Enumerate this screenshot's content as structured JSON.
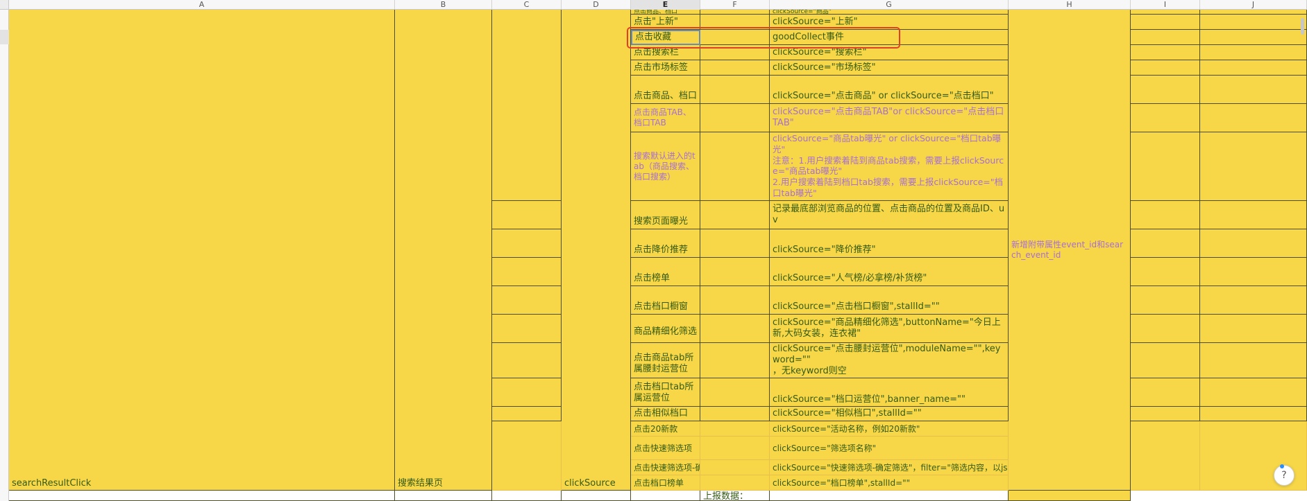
{
  "columns": [
    "A",
    "B",
    "C",
    "D",
    "E",
    "F",
    "G",
    "H",
    "I",
    "J"
  ],
  "merged": {
    "a_event": "searchResultClick",
    "b_page": "搜索结果页",
    "d_field": "clickSource",
    "h_note": "新增附带属性event_id和search_event_id"
  },
  "rows": [
    {
      "e": "点击\"上新\"",
      "g": "clickSource=\"上新\""
    },
    {
      "e": "点击收藏",
      "g": "goodCollect事件"
    },
    {
      "e": "点击搜索栏",
      "g": "clickSource=\"搜索栏\""
    },
    {
      "e": "点击市场标签",
      "g": "clickSource=\"市场标签\""
    },
    {
      "e": "点击商品、档口",
      "g": "clickSource=\"点击商品\" or clickSource=\"点击档口\""
    },
    {
      "e": "点击商品TAB、档口TAB",
      "g": "clickSource=\"点击商品TAB\"or clickSource=\"点击档口TAB\""
    },
    {
      "e": "搜索默认进入的tab（商品搜索、档口搜索）",
      "g": "clickSource=\"商品tab曝光\" or clickSource=\"档口tab曝光\"\n注意：1.用户搜索着陆到商品tab搜索，需要上报clickSource=\"商品tab曝光\"\n2.用户搜索着陆到档口tab搜索，需要上报clickSource=\"档口tab曝光\""
    },
    {
      "e": "搜索页面曝光",
      "g": "记录最底部浏览商品的位置、点击商品的位置及商品ID、uv"
    },
    {
      "e": "点击降价推荐",
      "g": "clickSource=\"降价推荐\""
    },
    {
      "e": "点击榜单",
      "g": "clickSource=\"人气榜/必拿榜/补货榜\""
    },
    {
      "e": "点击档口橱窗",
      "g": "clickSource=\"点击档口橱窗\",stallId=\"\""
    },
    {
      "e": "商品精细化筛选",
      "g": "clickSource=\"商品精细化筛选\",buttonName=\"今日上新,大码女装，连衣裙\""
    },
    {
      "e": "点击商品tab所属腰封运营位",
      "g": "clickSource=\"点击腰封运营位\",moduleName=\"\",keyword=\"\"\n，无keyword则空"
    },
    {
      "e": "点击档口tab所属运营位",
      "g": "clickSource=\"档口运营位\",banner_name=\"\""
    },
    {
      "e": "点击相似档口",
      "g": "clickSource=\"相似档口\",stallId=\"\""
    },
    {
      "e": "点击20新款",
      "g": "clickSource=\"活动名称，例如20新款\""
    },
    {
      "e": "点击快速筛选项",
      "g": "clickSource=\"筛选项名称\""
    },
    {
      "e": "点击快速筛选项-确定筛选",
      "g": "clickSource=\"快速筛选项-确定筛选\"，filter=\"筛选内容，以json"
    },
    {
      "e": "点击档口榜单",
      "g": "clickSource=\"档口榜单\",stallId=\"\""
    }
  ],
  "bottom_row": {
    "f": "上报数据："
  },
  "top_partial_row": {
    "e": "点击商品、档口",
    "g": "clickSource=\"商品\""
  },
  "help_icon": "?",
  "colors": {
    "cell_fill": "#f7d748",
    "text_green": "#355a14",
    "text_purple": "#a86fd0",
    "highlight_box": "#e0402a"
  }
}
